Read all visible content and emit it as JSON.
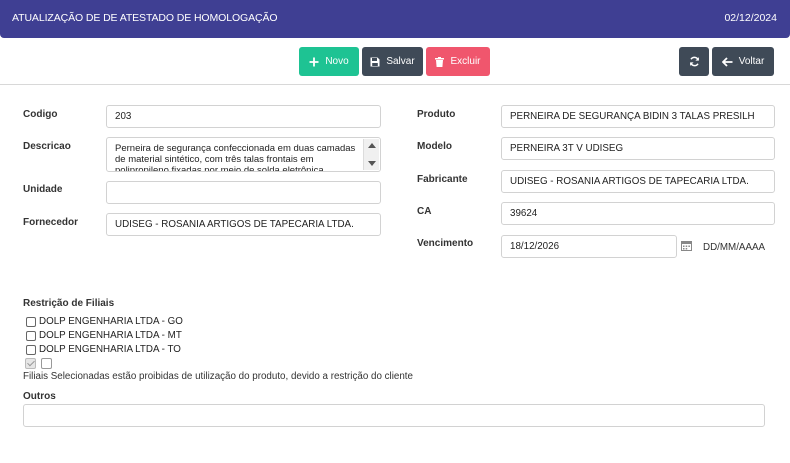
{
  "header": {
    "title": "ATUALIZAÇÃO DE DE ATESTADO DE HOMOLOGAÇÃO",
    "date": "02/12/2024"
  },
  "toolbar": {
    "novo": "Novo",
    "salvar": "Salvar",
    "excluir": "Excluir",
    "voltar": "Voltar",
    "icons": {
      "novo": "plus-icon",
      "salvar": "save-icon",
      "excluir": "trash-icon",
      "refresh": "refresh-icon",
      "voltar": "arrow-left-icon"
    },
    "colors": {
      "novo": "#1ec393",
      "salvar": "#3f4a57",
      "excluir": "#f0566d",
      "dark": "#3f4a57"
    }
  },
  "form": {
    "codigo": {
      "label": "Codigo",
      "value": "203"
    },
    "descricao": {
      "label": "Descricao",
      "value": "Perneira de segurança confeccionada em duas camadas de material sintético, com três talas frontais em polipropileno fixadas por meio de solda eletrônica"
    },
    "unidade": {
      "label": "Unidade",
      "value": ""
    },
    "fornecedor": {
      "label": "Fornecedor",
      "value": "UDISEG - ROSANIA ARTIGOS DE TAPECARIA LTDA."
    },
    "produto": {
      "label": "Produto",
      "value": "PERNEIRA DE SEGURANÇA BIDIN 3 TALAS PRESILH"
    },
    "modelo": {
      "label": "Modelo",
      "value": "PERNEIRA 3T V UDISEG"
    },
    "fabricante": {
      "label": "Fabricante",
      "value": "UDISEG - ROSANIA ARTIGOS DE TAPECARIA LTDA."
    },
    "ca": {
      "label": "CA",
      "value": "39624"
    },
    "vencimento": {
      "label": "Vencimento",
      "value": "18/12/2026",
      "format": "DD/MM/AAAA"
    }
  },
  "restricao": {
    "title": "Restrição de Filiais",
    "filiais": [
      {
        "label": "DOLP ENGENHARIA LTDA - GO",
        "checked": false
      },
      {
        "label": "DOLP ENGENHARIA LTDA - MT",
        "checked": false
      },
      {
        "label": "DOLP ENGENHARIA LTDA - TO",
        "checked": false
      }
    ],
    "note": "Filiais Selecionadas estão proibidas de utilização do produto, devido a restrição do cliente"
  },
  "outros": {
    "label": "Outros",
    "value": ""
  }
}
